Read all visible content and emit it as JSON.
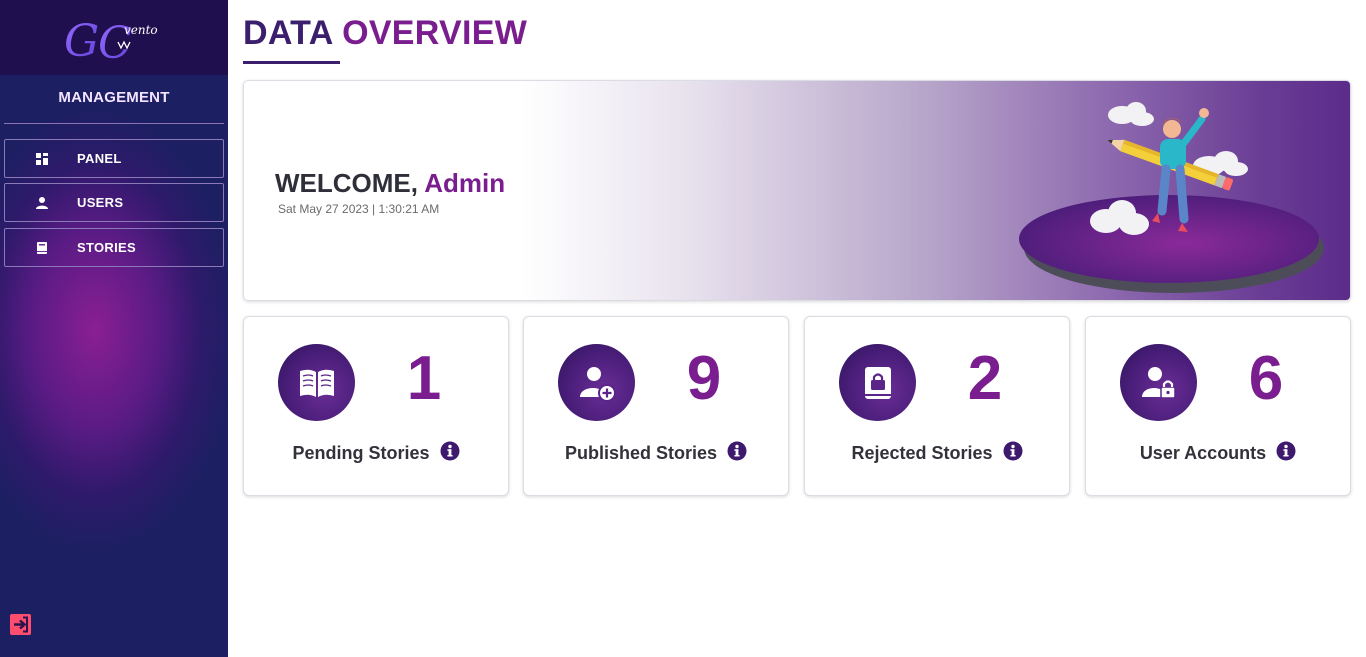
{
  "sidebar": {
    "logo_text": "GC vento",
    "heading": "MANAGEMENT",
    "items": [
      {
        "label": "PANEL",
        "icon": "grid-icon"
      },
      {
        "label": "USERS",
        "icon": "user-icon"
      },
      {
        "label": "STORIES",
        "icon": "book-icon"
      }
    ],
    "logout_icon": "logout-icon",
    "colors": {
      "accent": "#7a1d8e",
      "dark": "#1f0f4f",
      "logout": "#ff4d6d"
    }
  },
  "page": {
    "title_part1": "DATA",
    "title_part2": "OVERVIEW"
  },
  "welcome": {
    "greeting": "WELCOME,",
    "name": "Admin",
    "datetime": "Sat May 27 2023 | 1:30:21 AM"
  },
  "stats": [
    {
      "label": "Pending Stories",
      "value": "1",
      "icon": "open-book-icon"
    },
    {
      "label": "Published Stories",
      "value": "9",
      "icon": "add-user-icon"
    },
    {
      "label": "Rejected Stories",
      "value": "2",
      "icon": "locked-book-icon"
    },
    {
      "label": "User Accounts",
      "value": "6",
      "icon": "user-lock-icon"
    }
  ]
}
